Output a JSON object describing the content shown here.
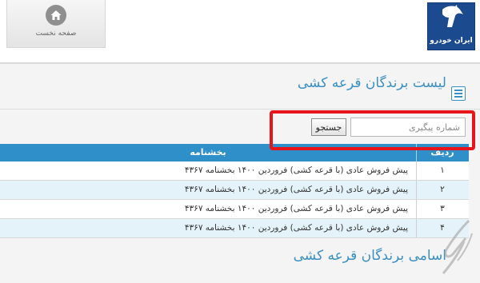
{
  "header": {
    "home_label": "صفحه نخست",
    "logo_text": "ایران خودرو"
  },
  "section": {
    "title": "لیست برندگان قرعه کشی",
    "icon": "list-icon"
  },
  "search": {
    "placeholder": "شماره پیگیری",
    "button_label": "جستجو"
  },
  "table": {
    "columns": [
      "ردیف",
      "بخشنامه"
    ],
    "rows": [
      {
        "num": "۱",
        "name": "پیش فروش عادی (با قرعه کشی) فروردین ۱۴۰۰ بخشنامه ۴۳۶۷"
      },
      {
        "num": "۲",
        "name": "پیش فروش عادی (با قرعه کشی) فروردین ۱۴۰۰ بخشنامه ۴۳۶۷"
      },
      {
        "num": "۳",
        "name": "پیش فروش عادی (با قرعه کشی) فروردین ۱۴۰۰ بخشنامه ۴۳۶۷"
      },
      {
        "num": "۴",
        "name": "پیش فروش عادی (با قرعه کشی) فروردین ۱۴۰۰ بخشنامه ۴۳۶۷"
      }
    ]
  },
  "second_section": {
    "title": "اسامی برندگان قرعه کشی"
  },
  "colors": {
    "accent": "#3a8fc4",
    "table_header": "#2e8fc9",
    "highlight": "#e8141c",
    "logo_bg": "#1b4a8f"
  }
}
